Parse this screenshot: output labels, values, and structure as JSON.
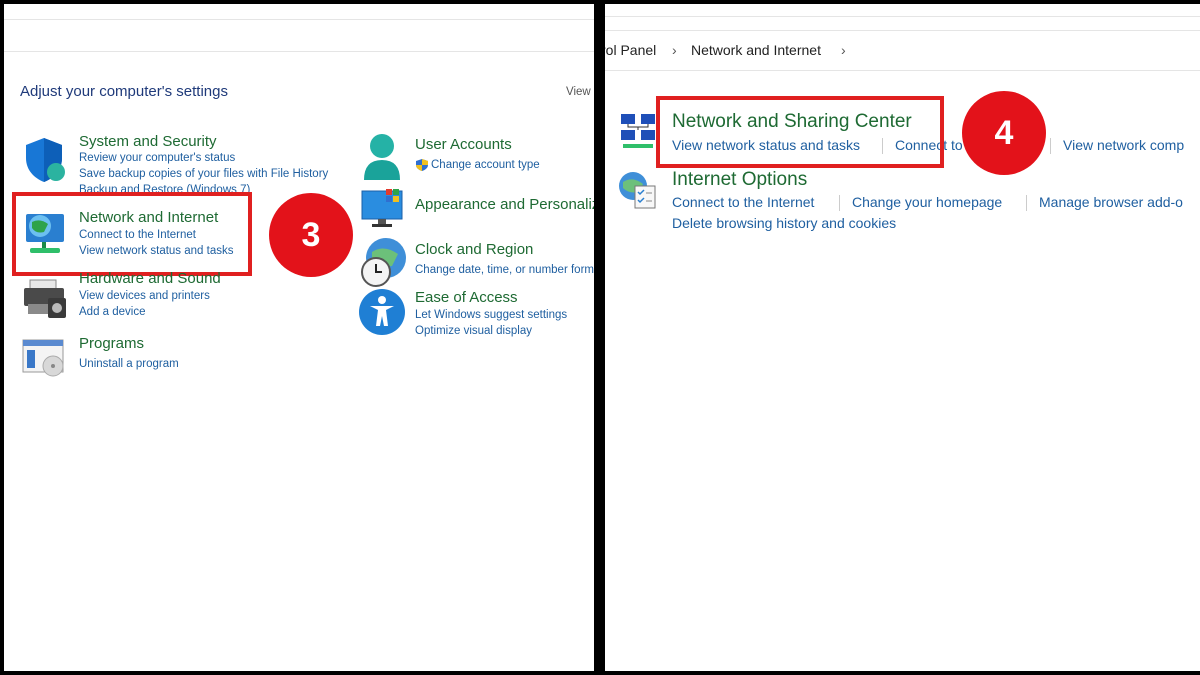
{
  "left": {
    "heading": "Adjust your computer's settings",
    "view_partial": "View",
    "categories": {
      "system": {
        "title": "System and Security",
        "links": [
          "Review your computer's status",
          "Save backup copies of your files with File History",
          "Backup and Restore (Windows 7)"
        ]
      },
      "network": {
        "title": "Network and Internet",
        "links": [
          "Connect to the Internet",
          "View network status and tasks"
        ]
      },
      "hardware": {
        "title": "Hardware and Sound",
        "links": [
          "View devices and printers",
          "Add a device"
        ]
      },
      "programs": {
        "title": "Programs",
        "links": [
          "Uninstall a program"
        ]
      },
      "user": {
        "title": "User Accounts",
        "links": [
          "Change account type"
        ]
      },
      "appearance": {
        "title": "Appearance and Personaliz"
      },
      "clock": {
        "title": "Clock and Region",
        "links": [
          "Change date, time, or number form"
        ]
      },
      "ease": {
        "title": "Ease of Access",
        "links": [
          "Let Windows suggest settings",
          "Optimize visual display"
        ]
      }
    },
    "step_badge": "3"
  },
  "right": {
    "breadcrumb": [
      "rol Panel",
      "Network and Internet"
    ],
    "sharing": {
      "title": "Network and Sharing Center",
      "links": [
        "View network status and tasks",
        "Connect to",
        "View network comp"
      ]
    },
    "internet_options": {
      "title": "Internet Options",
      "links": [
        "Connect to the Internet",
        "Change your homepage",
        "Manage browser add-o",
        "Delete browsing history and cookies"
      ]
    },
    "step_badge": "4"
  },
  "colors": {
    "accent_red": "#e02020",
    "badge_red": "#e3121a",
    "link_blue": "#1f5fa0",
    "category_green": "#1e6a33"
  }
}
